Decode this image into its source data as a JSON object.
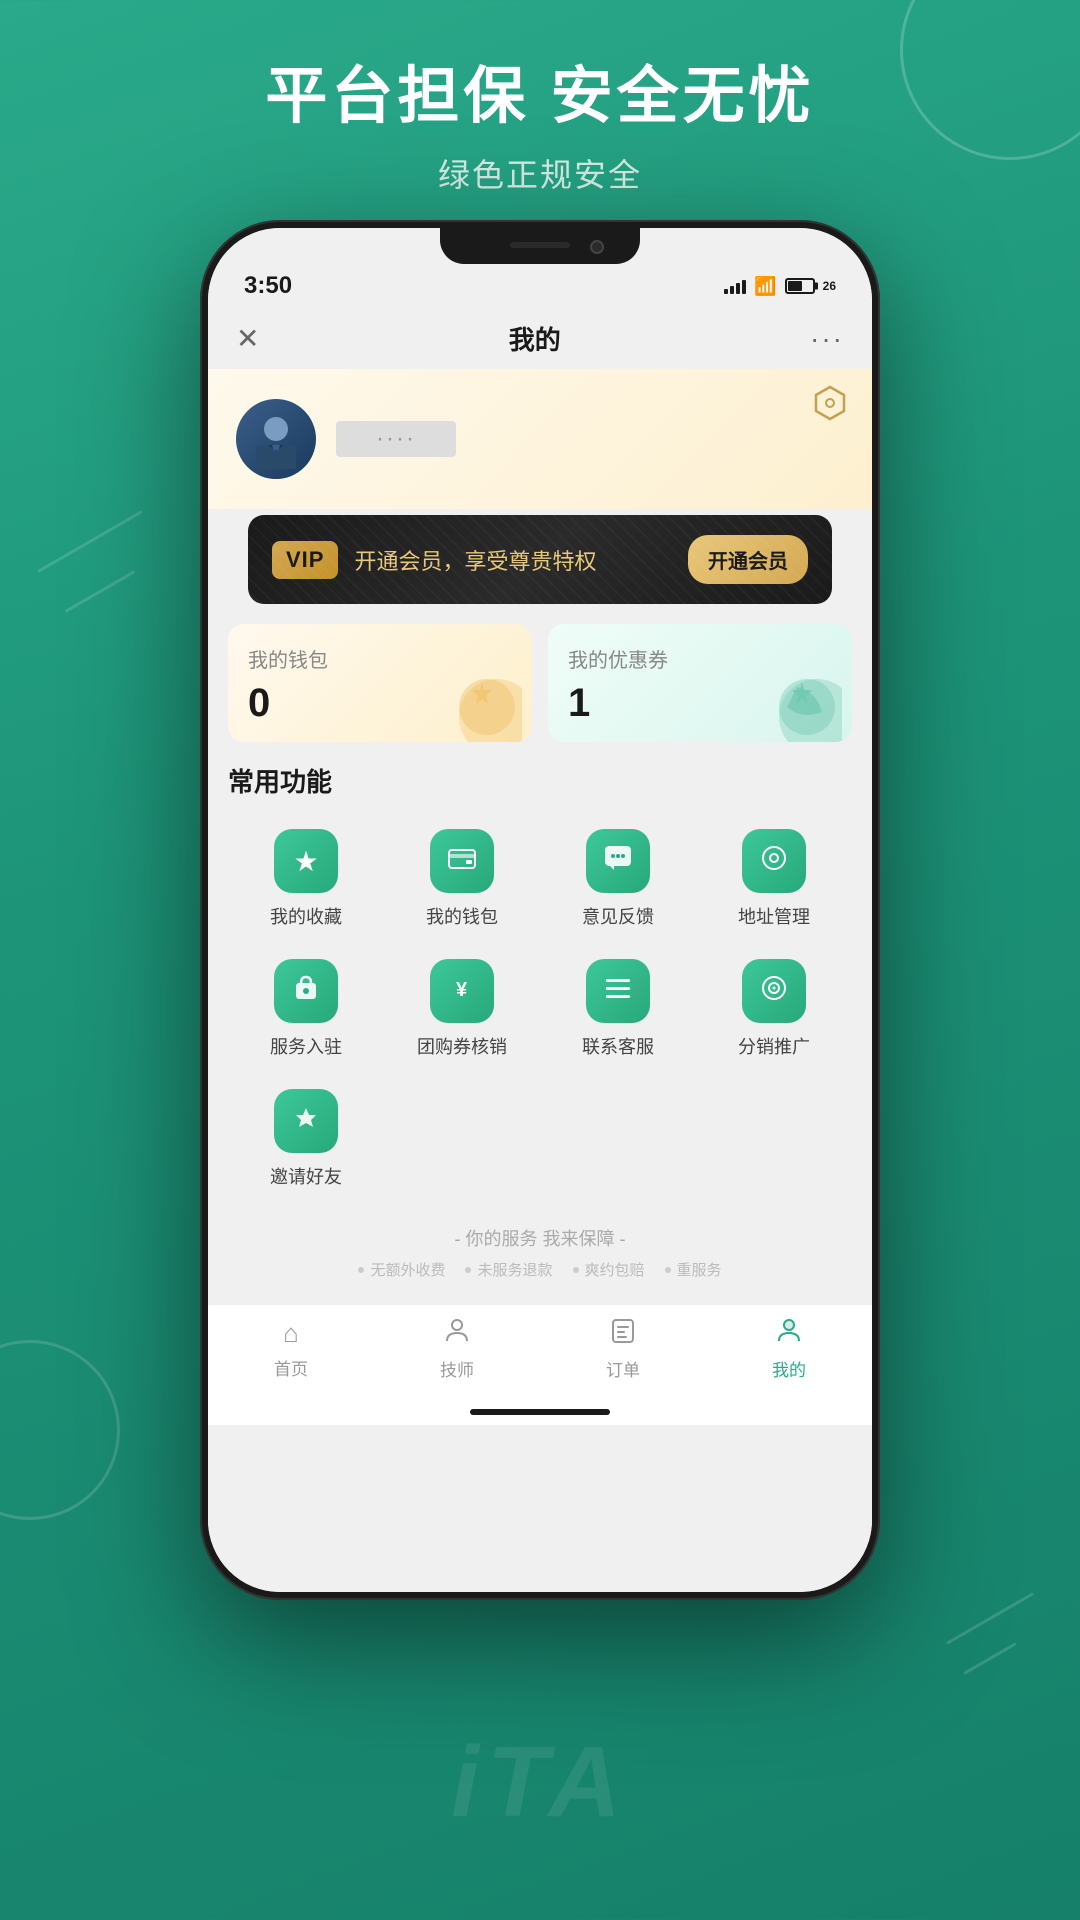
{
  "background": {
    "gradient_start": "#2aaa8a",
    "gradient_end": "#16806a"
  },
  "header": {
    "title": "平台担保 安全无忧",
    "subtitle": "绿色正规安全"
  },
  "phone": {
    "status_bar": {
      "time": "3:50",
      "battery_label": "26"
    },
    "navbar": {
      "title": "我的",
      "close_icon": "✕",
      "more_icon": "···"
    },
    "profile": {
      "name_placeholder": "····"
    },
    "vip_banner": {
      "badge": "VIP",
      "text": "开通会员，享受尊贵特权",
      "button": "开通会员"
    },
    "wallet_card": {
      "label": "我的钱包",
      "value": "0"
    },
    "coupon_card": {
      "label": "我的优惠券",
      "value": "1"
    },
    "functions": {
      "title": "常用功能",
      "items": [
        {
          "icon": "★",
          "label": "我的收藏"
        },
        {
          "icon": "−",
          "label": "我的钱包"
        },
        {
          "icon": "···",
          "label": "意见反馈"
        },
        {
          "icon": "⊙",
          "label": "地址管理"
        },
        {
          "icon": "🎁",
          "label": "服务入驻"
        },
        {
          "icon": "¥",
          "label": "团购券核销"
        },
        {
          "icon": "≡",
          "label": "联系客服"
        },
        {
          "icon": "⊙",
          "label": "分销推广"
        },
        {
          "icon": "♛",
          "label": "邀请好友"
        }
      ]
    },
    "service": {
      "title": "- 你的服务 我来保障 -",
      "items": [
        "无额外收费",
        "未服务退款",
        "爽约包赔",
        "重服务"
      ]
    },
    "bottom_nav": {
      "items": [
        {
          "icon": "⌂",
          "label": "首页",
          "active": false
        },
        {
          "icon": "👤",
          "label": "技师",
          "active": false
        },
        {
          "icon": "📋",
          "label": "订单",
          "active": false
        },
        {
          "icon": "👤",
          "label": "我的",
          "active": true
        }
      ]
    },
    "watermark": "iTA"
  }
}
